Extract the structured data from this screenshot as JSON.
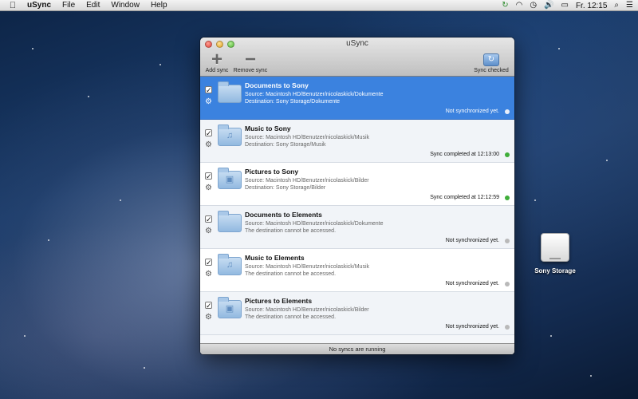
{
  "menubar": {
    "app_name": "uSync",
    "menus": [
      "File",
      "Edit",
      "Window",
      "Help"
    ],
    "clock": "Fr. 12:15"
  },
  "window": {
    "title": "uSync",
    "toolbar": {
      "add_label": "Add sync",
      "remove_label": "Remove sync",
      "sync_label": "Sync checked"
    },
    "syncs": [
      {
        "name": "Documents to Sony",
        "source": "Source: Macintosh HD/Benutzer/nicolaskick/Dokumente",
        "destination": "Destination: Sony Storage/Dokumente",
        "status": "Not synchronized yet.",
        "icon": "folder-icon",
        "checked": true,
        "selected": true
      },
      {
        "name": "Music to Sony",
        "source": "Source: Macintosh HD/Benutzer/nicolaskick/Musik",
        "destination": "Destination: Sony Storage/Musik",
        "status": "Sync completed at 12:13:00",
        "icon": "music-folder-icon",
        "checked": true,
        "selected": false
      },
      {
        "name": "Pictures to Sony",
        "source": "Source: Macintosh HD/Benutzer/nicolaskick/Bilder",
        "destination": "Destination: Sony Storage/Bilder",
        "status": "Sync completed at 12:12:59",
        "icon": "pictures-folder-icon",
        "checked": true,
        "selected": false
      },
      {
        "name": "Documents to Elements",
        "source": "Source: Macintosh HD/Benutzer/nicolaskick/Dokumente",
        "destination": "The destination cannot be accessed.",
        "status": "Not synchronized yet.",
        "icon": "folder-icon",
        "checked": true,
        "selected": false
      },
      {
        "name": "Music to Elements",
        "source": "Source: Macintosh HD/Benutzer/nicolaskick/Musik",
        "destination": "The destination cannot be accessed.",
        "status": "Not synchronized yet.",
        "icon": "music-folder-icon",
        "checked": true,
        "selected": false
      },
      {
        "name": "Pictures to Elements",
        "source": "Source: Macintosh HD/Benutzer/nicolaskick/Bilder",
        "destination": "The destination cannot be accessed.",
        "status": "Not synchronized yet.",
        "icon": "pictures-folder-icon",
        "checked": true,
        "selected": false
      }
    ],
    "statusbar": "No syncs are running"
  },
  "desktop": {
    "drive_label": "Sony Storage"
  }
}
